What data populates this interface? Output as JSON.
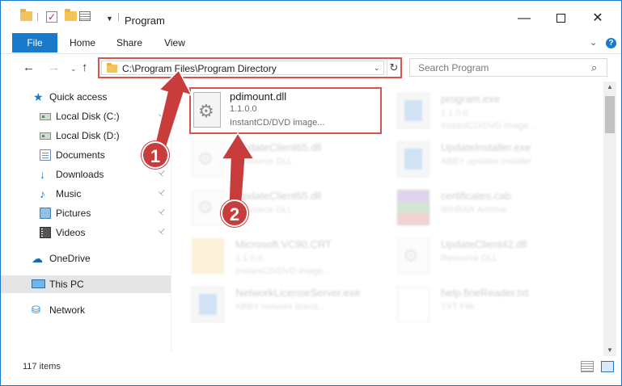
{
  "window": {
    "title": "Program",
    "controls": {
      "minimize": "—",
      "maximize": "",
      "close": "✕"
    }
  },
  "quick_access_toolbar": {
    "icons": [
      "folder-icon",
      "properties-check-icon",
      "new-folder-icon",
      "properties-icon",
      "customize-dropdown-icon"
    ]
  },
  "ribbon": {
    "tabs": [
      "File",
      "Home",
      "Share",
      "View"
    ],
    "expand_glyph": "⌄",
    "help_glyph": "?"
  },
  "navigation": {
    "back": "←",
    "forward": "→",
    "recent": "⌄",
    "up": "↑"
  },
  "address_bar": {
    "path": "C:\\Program Files\\Program Directory",
    "dropdown": "⌄",
    "refresh": "↻"
  },
  "search": {
    "placeholder": "Search Program",
    "icon": "⌕"
  },
  "sidebar": {
    "items": [
      {
        "label": "Quick access",
        "icon": "star-icon",
        "glyph": "★",
        "pinned": false
      },
      {
        "label": "Local Disk (C:)",
        "icon": "drive-icon",
        "glyph": "",
        "pinned": true
      },
      {
        "label": "Local Disk (D:)",
        "icon": "drive-icon",
        "glyph": "",
        "pinned": false
      },
      {
        "label": "Documents",
        "icon": "documents-icon",
        "glyph": "",
        "pinned": true
      },
      {
        "label": "Downloads",
        "icon": "downloads-icon",
        "glyph": "↓",
        "pinned": true
      },
      {
        "label": "Music",
        "icon": "music-icon",
        "glyph": "♪",
        "pinned": true
      },
      {
        "label": "Pictures",
        "icon": "pictures-icon",
        "glyph": "",
        "pinned": true
      },
      {
        "label": "Videos",
        "icon": "videos-icon",
        "glyph": "",
        "pinned": true
      },
      {
        "label": "OneDrive",
        "icon": "onedrive-icon",
        "glyph": "☁",
        "pinned": false
      },
      {
        "label": "This PC",
        "icon": "this-pc-icon",
        "glyph": "",
        "pinned": false,
        "selected": true
      },
      {
        "label": "Network",
        "icon": "network-icon",
        "glyph": "⛁",
        "pinned": false
      }
    ],
    "pin_glyph": "📌"
  },
  "files": {
    "highlighted": {
      "name": "pdimount.dll",
      "version": "1.1.0.0",
      "description": "InstantCD/DVD image..."
    },
    "others": [
      {
        "name": "program.exe",
        "line1": "1.1.0.0",
        "line2": "InstantCD/DVD image...",
        "type": "exe"
      },
      {
        "name": "UpdateClient65.dll",
        "line1": "Resource DLL",
        "line2": "",
        "type": "dll"
      },
      {
        "name": "UpdateInstaller.exe",
        "line1": "ABBY updates installer",
        "line2": "",
        "type": "exe"
      },
      {
        "name": "UpdateClient65.dll",
        "line1": "Resource DLL",
        "line2": "",
        "type": "dll"
      },
      {
        "name": "certificates.cab",
        "line1": "WinRAR Archive",
        "line2": "",
        "type": "cab"
      },
      {
        "name": "Microsoft.VC90.CRT",
        "line1": "1.1.0.0",
        "line2": "InstantCD/DVD image...",
        "type": "folder"
      },
      {
        "name": "UpdateClient42.dll",
        "line1": "Resource DLL",
        "line2": "",
        "type": "dll"
      },
      {
        "name": "NetworkLicenseServer.exe",
        "line1": "ABBY network licens...",
        "line2": "",
        "type": "exe"
      },
      {
        "name": "help.fineReader.txt",
        "line1": "TXT File",
        "line2": "",
        "type": "txt"
      }
    ]
  },
  "annotations": {
    "callout_1": "1",
    "callout_2": "2"
  },
  "status_bar": {
    "item_count": "117 items"
  },
  "colors": {
    "accent": "#1979ca",
    "highlight_border": "#d9534f",
    "callout": "#c83c3c"
  }
}
